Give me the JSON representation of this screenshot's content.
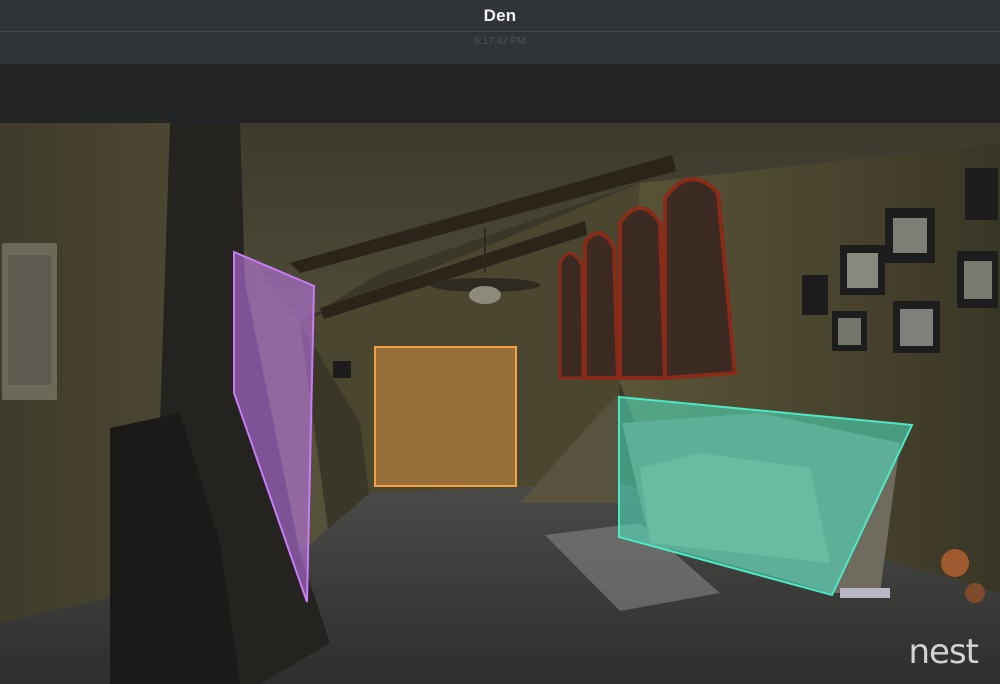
{
  "header": {
    "title": "Den"
  },
  "subheader": {
    "timestamp": "6:17:42 PM"
  },
  "feed": {
    "brand_logo": "nest",
    "zones": [
      {
        "name": "window",
        "color": "#c77cf5"
      },
      {
        "name": "doorway",
        "color": "#f2a243"
      },
      {
        "name": "couch",
        "color": "#4fe8c4"
      }
    ]
  },
  "colors": {
    "header_bg": "#303337",
    "page_bg": "#222426",
    "zone_purple": "#c77cf5",
    "zone_orange": "#f2a243",
    "zone_teal": "#4fe8c4"
  }
}
